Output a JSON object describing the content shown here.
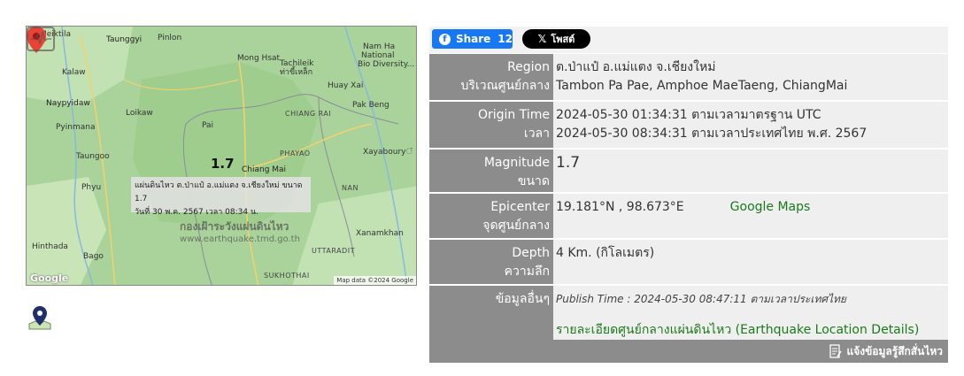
{
  "map": {
    "labels": {
      "meiktila": "Meiktila",
      "taunggyi": "Taunggyi",
      "pinlon": "Pinlon",
      "mong_hsat": "Mong Hsat",
      "nam_ha": "Nam Ha",
      "nam_ha_2": "National",
      "nam_ha_3": "Bio Diversity...",
      "kalaw": "Kalaw",
      "tachileik": "Tachileik",
      "tachileik_th": "ท่าขี้เหล็ก",
      "huay_xai": "Huay Xai",
      "pak_beng": "Pak Beng",
      "naypyidaw": "Naypyidaw",
      "loikaw": "Loikaw",
      "pyinmana": "Pyinmana",
      "chiang_rai": "CHIANG RAI",
      "pai": "Pai",
      "phayao": "PHAYAO",
      "taungoo": "Taungoo",
      "chiang_mai": "Chiang Mai",
      "xayaboury": "Xayabouryਂ",
      "phyu": "Phyu",
      "nan": "NAN",
      "hinthada": "Hinthada",
      "xanamkhan": "Xanamkhan",
      "bago": "Bago",
      "uttaradit": "UTTARADIT",
      "sukhothai": "SUKHOTHAI"
    },
    "magnitude_label": "1.7",
    "info_line1": "แผ่นดินไหว ต.ป่าแป๋ อ.แม่แตง จ.เชียงใหม่ ขนาด 1.7",
    "info_line2": "วันที่ 30 พ.ค. 2567 เวลา 08:34 น.",
    "watermark_title": "กองเฝ้าระวังแผ่นดินไหว",
    "watermark_url": "www.earthquake.tmd.go.th",
    "google_logo": "Google",
    "map_data": "Map data ©2024 Google"
  },
  "share": {
    "fb_label": "Share",
    "fb_count": "12",
    "x_label": "โพสต์"
  },
  "table": {
    "region_label_en": "Region",
    "region_label_th": "บริเวณศูนย์กลาง",
    "region_th": "ต.ป่าแป๋ อ.แม่แตง จ.เชียงใหม่",
    "region_en": "Tambon Pa Pae, Amphoe MaeTaeng, ChiangMai",
    "origin_label_en": "Origin Time",
    "origin_label_th": "เวลา",
    "origin_utc": "2024-05-30 01:34:31 ตามเวลามาตรฐาน UTC",
    "origin_local": "2024-05-30 08:34:31 ตามเวลาประเทศไทย พ.ศ. 2567",
    "mag_label_en": "Magnitude",
    "mag_label_th": "ขนาด",
    "mag_value": "1.7",
    "epi_label_en": "Epicenter",
    "epi_label_th": "จุดศูนย์กลาง",
    "epi_value": "19.181°N , 98.673°E",
    "epi_link": "Google Maps",
    "depth_label_en": "Depth",
    "depth_label_th": "ความลึก",
    "depth_value": "4 Km. (กิโลเมตร)",
    "other_label": "ข้อมูลอื่นๆ",
    "publish_time": "Publish Time : 2024-05-30 08:47:11 ตามเวลาประเทศไทย",
    "detail_link": "รายละเอียดศูนย์กลางแผ่นดินไหว (Earthquake Location Details)"
  },
  "footer": {
    "report_label": "แจ้งข้อมูลรู้สึกสั่นไหว"
  }
}
